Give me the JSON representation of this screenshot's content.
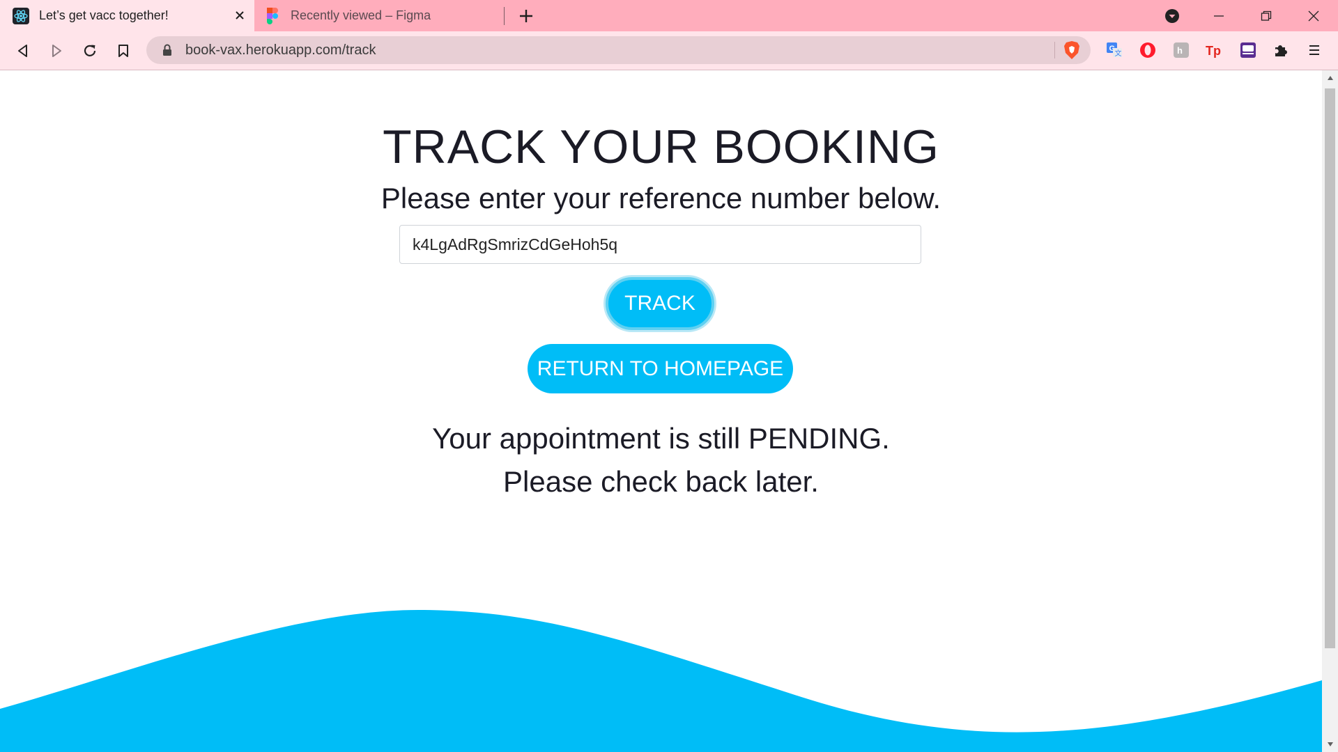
{
  "browser": {
    "tabs": [
      {
        "title": "Let’s get vacc together!",
        "icon": "react-icon",
        "active": true
      },
      {
        "title": "Recently viewed – Figma",
        "icon": "figma-icon",
        "active": false
      }
    ],
    "url": "book-vax.herokuapp.com/track",
    "accent_color": "#ffadbc",
    "toolbar_color": "#ffe4ea",
    "extensions": [
      "translate-icon",
      "opera-icon",
      "hacker-news-icon",
      "tp-icon",
      "purple-extension-icon",
      "puzzle-icon",
      "menu-icon"
    ]
  },
  "page": {
    "title": "TRACK YOUR BOOKING",
    "subtitle": "Please enter your reference number below.",
    "reference_input_value": "k4LgAdRgSmrizCdGeHoh5q",
    "track_button": "TRACK",
    "home_button": "RETURN TO HOMEPAGE",
    "status_line1": "Your appointment is still PENDING.",
    "status_line2": "Please check back later.",
    "brand_color": "#00bdf7"
  }
}
